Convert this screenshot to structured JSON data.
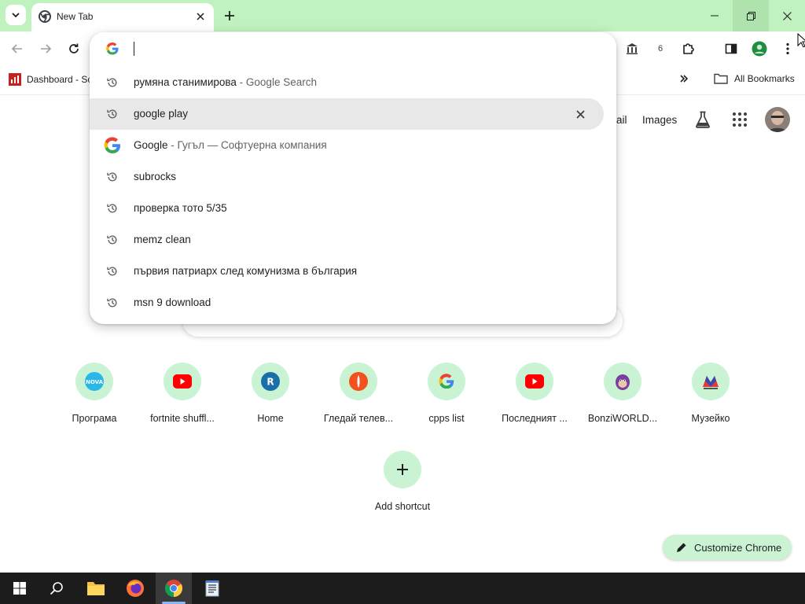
{
  "window": {
    "tab_title": "New Tab",
    "accent": "#bff2bf"
  },
  "bookmarks_bar": {
    "first_item": "Dashboard - Sc",
    "all_bookmarks": "All Bookmarks"
  },
  "toolbar": {
    "extension_badge": "6"
  },
  "omnibox": {
    "value": "",
    "suggestions": [
      {
        "icon": "history-icon",
        "text": "румяна станимирова",
        "sub": " - Google Search"
      },
      {
        "icon": "history-icon",
        "text": "google play",
        "sub": ""
      },
      {
        "icon": "google-icon",
        "text": "Google",
        "sub": " - Гугъл — Софтуерна компания"
      },
      {
        "icon": "history-icon",
        "text": "subrocks",
        "sub": ""
      },
      {
        "icon": "history-icon",
        "text": "проверка тото 5/35",
        "sub": ""
      },
      {
        "icon": "history-icon",
        "text": "memz clean",
        "sub": ""
      },
      {
        "icon": "history-icon",
        "text": "първия патриарх след комунизма в българия",
        "sub": ""
      },
      {
        "icon": "history-icon",
        "text": "msn 9 download",
        "sub": ""
      }
    ]
  },
  "ntp": {
    "gmail_partial": "ail",
    "images": "Images",
    "shortcuts": [
      {
        "label": "Програма",
        "icon": "nova-icon"
      },
      {
        "label": "fortnite shuffl...",
        "icon": "youtube-icon"
      },
      {
        "label": "Home",
        "icon": "r-icon"
      },
      {
        "label": "Гледай телев...",
        "icon": "tv-icon"
      },
      {
        "label": "cpps list",
        "icon": "google-icon"
      },
      {
        "label": "Последният ...",
        "icon": "youtube-icon"
      },
      {
        "label": "BonziWORLD...",
        "icon": "bonzi-icon"
      },
      {
        "label": "Музейко",
        "icon": "muzeiko-icon"
      }
    ],
    "add_shortcut": "Add shortcut",
    "customize": "Customize Chrome"
  }
}
